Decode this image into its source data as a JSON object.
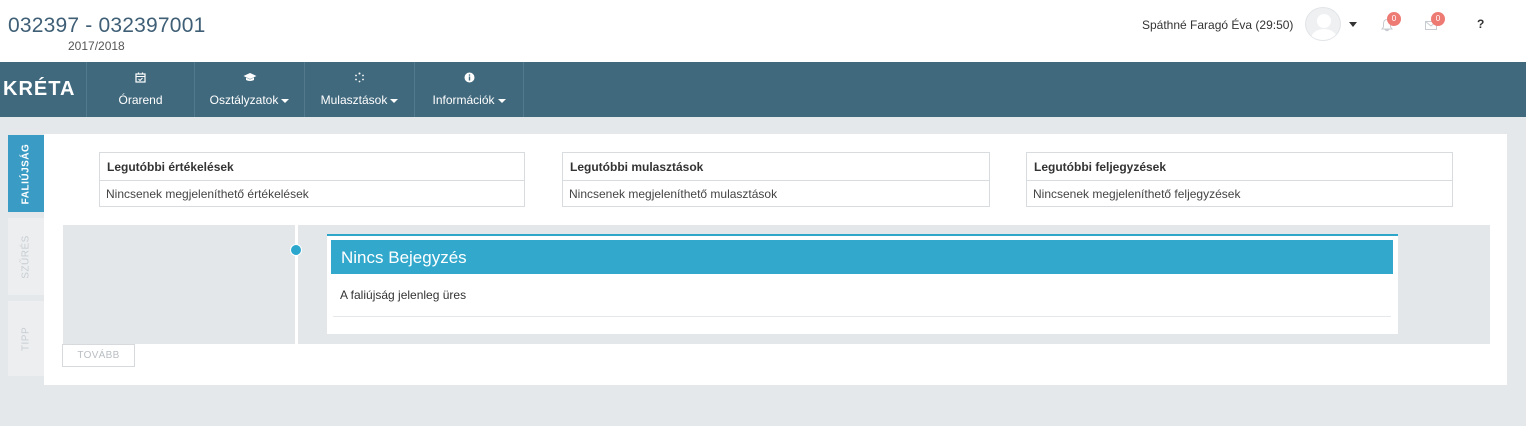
{
  "header": {
    "title": "032397 - 032397001",
    "year": "2017/2018",
    "user": "Spáthné Faragó Éva (29:50)",
    "notifications_count": "0",
    "messages_count": "0",
    "help": "?"
  },
  "nav": {
    "logo": "KRÉTA",
    "items": [
      {
        "label": "Órarend",
        "icon": "calendar-icon"
      },
      {
        "label": "Osztályzatok",
        "icon": "graduation-cap-icon"
      },
      {
        "label": "Mulasztások",
        "icon": "spinner-icon"
      },
      {
        "label": "Információk",
        "icon": "info-icon"
      }
    ]
  },
  "sidetabs": {
    "faliujsag": "FALIÚJSÁG",
    "szures": "SZŰRÉS",
    "tipp": "TIPP"
  },
  "boxes": [
    {
      "title": "Legutóbbi értékelések",
      "text": "Nincsenek megjeleníthető értékelések"
    },
    {
      "title": "Legutóbbi mulasztások",
      "text": "Nincsenek megjeleníthető mulasztások"
    },
    {
      "title": "Legutóbbi feljegyzések",
      "text": "Nincsenek megjeleníthető feljegyzések"
    }
  ],
  "entry": {
    "title": "Nincs Bejegyzés",
    "text": "A faliújság jelenleg üres"
  },
  "more_button": "TOVÁBB",
  "colors": {
    "nav_bg": "#41697d",
    "accent": "#31a8cc",
    "badge": "#ee7a74"
  }
}
